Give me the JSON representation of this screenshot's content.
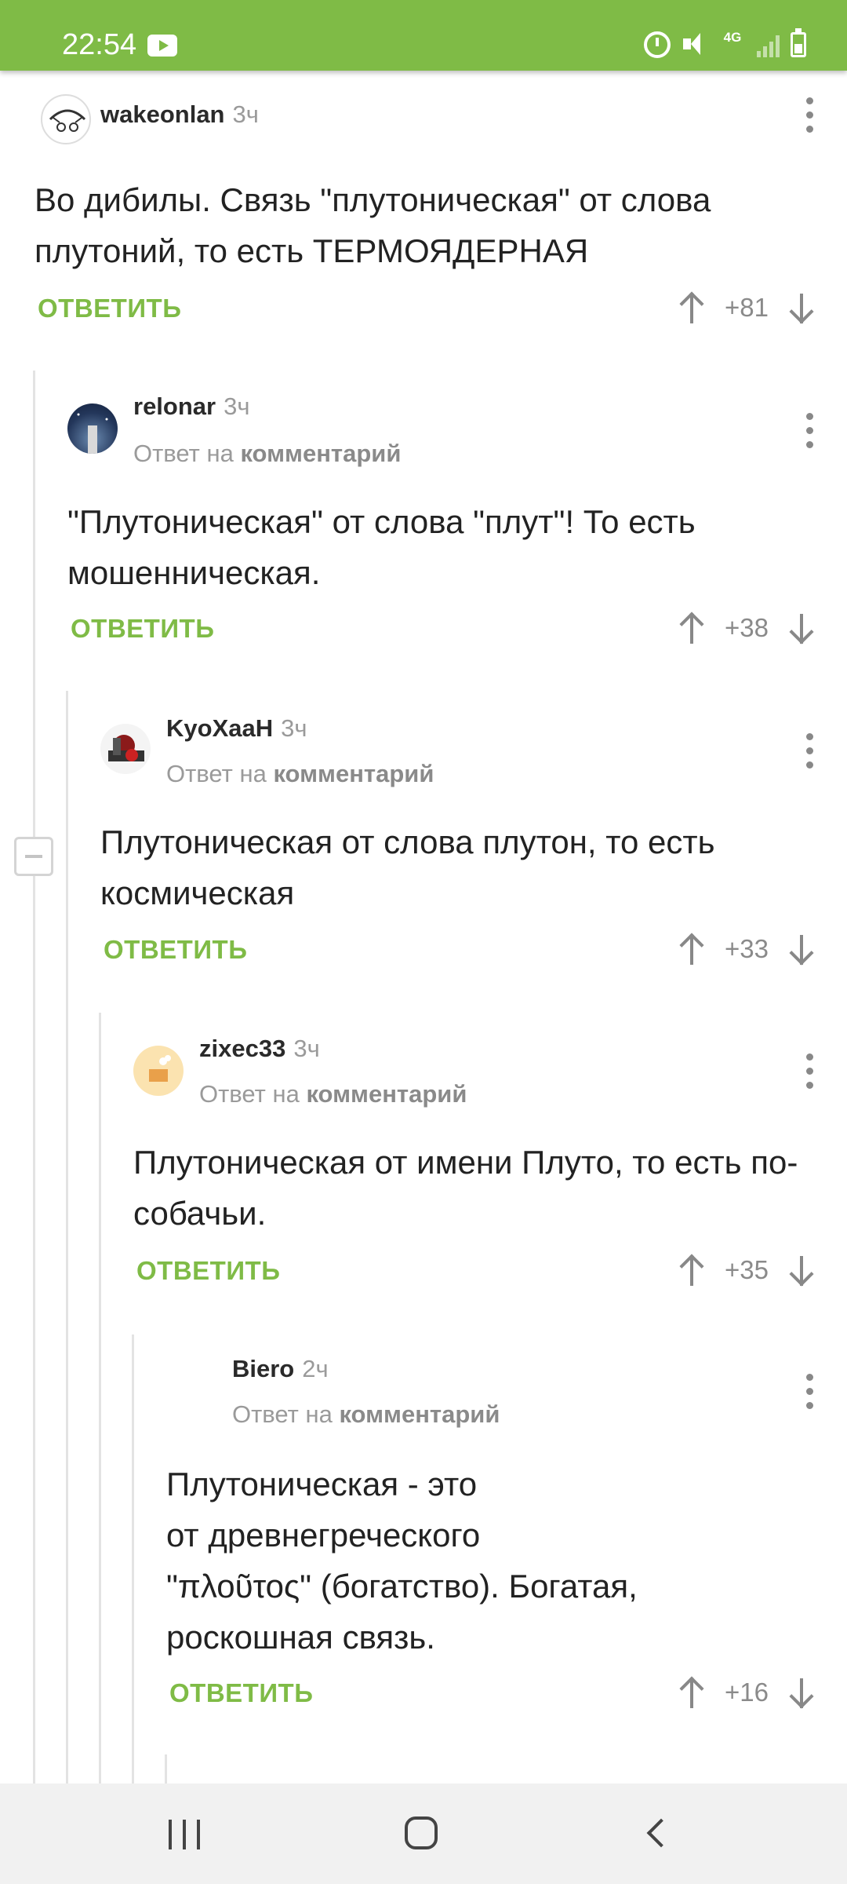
{
  "status_bar": {
    "time": "22:54",
    "network": "4G"
  },
  "reply_label": "ОТВЕТИТЬ",
  "reply_prefix": "Ответ на",
  "reply_target": "комментарий",
  "comments": [
    {
      "author": "wakeonlan",
      "time": "3ч",
      "is_reply": false,
      "text": "Во дибилы. Связь \"плутоническая\" от слова плутоний, то есть ТЕРМОЯДЕРНАЯ",
      "score": "+81"
    },
    {
      "author": "relonar",
      "time": "3ч",
      "is_reply": true,
      "text": "\"Плутоническая\" от слова \"плут\"! То есть мошенническая.",
      "score": "+38"
    },
    {
      "author": "KyoXaaH",
      "time": "3ч",
      "is_reply": true,
      "text": "Плутоническая от слова плутон,  то есть космическая",
      "score": "+33"
    },
    {
      "author": "zixec33",
      "time": "3ч",
      "is_reply": true,
      "text": "Плутоническая от имени Плуто, то есть по-собачьи.",
      "score": "+35"
    },
    {
      "author": "Biero",
      "time": "2ч",
      "is_reply": true,
      "text": "Плутоническая - это\nот древнегреческого\n\"πλοῦτος\" (богатство). Богатая,\nроскошная связь.",
      "score": "+16"
    }
  ]
}
